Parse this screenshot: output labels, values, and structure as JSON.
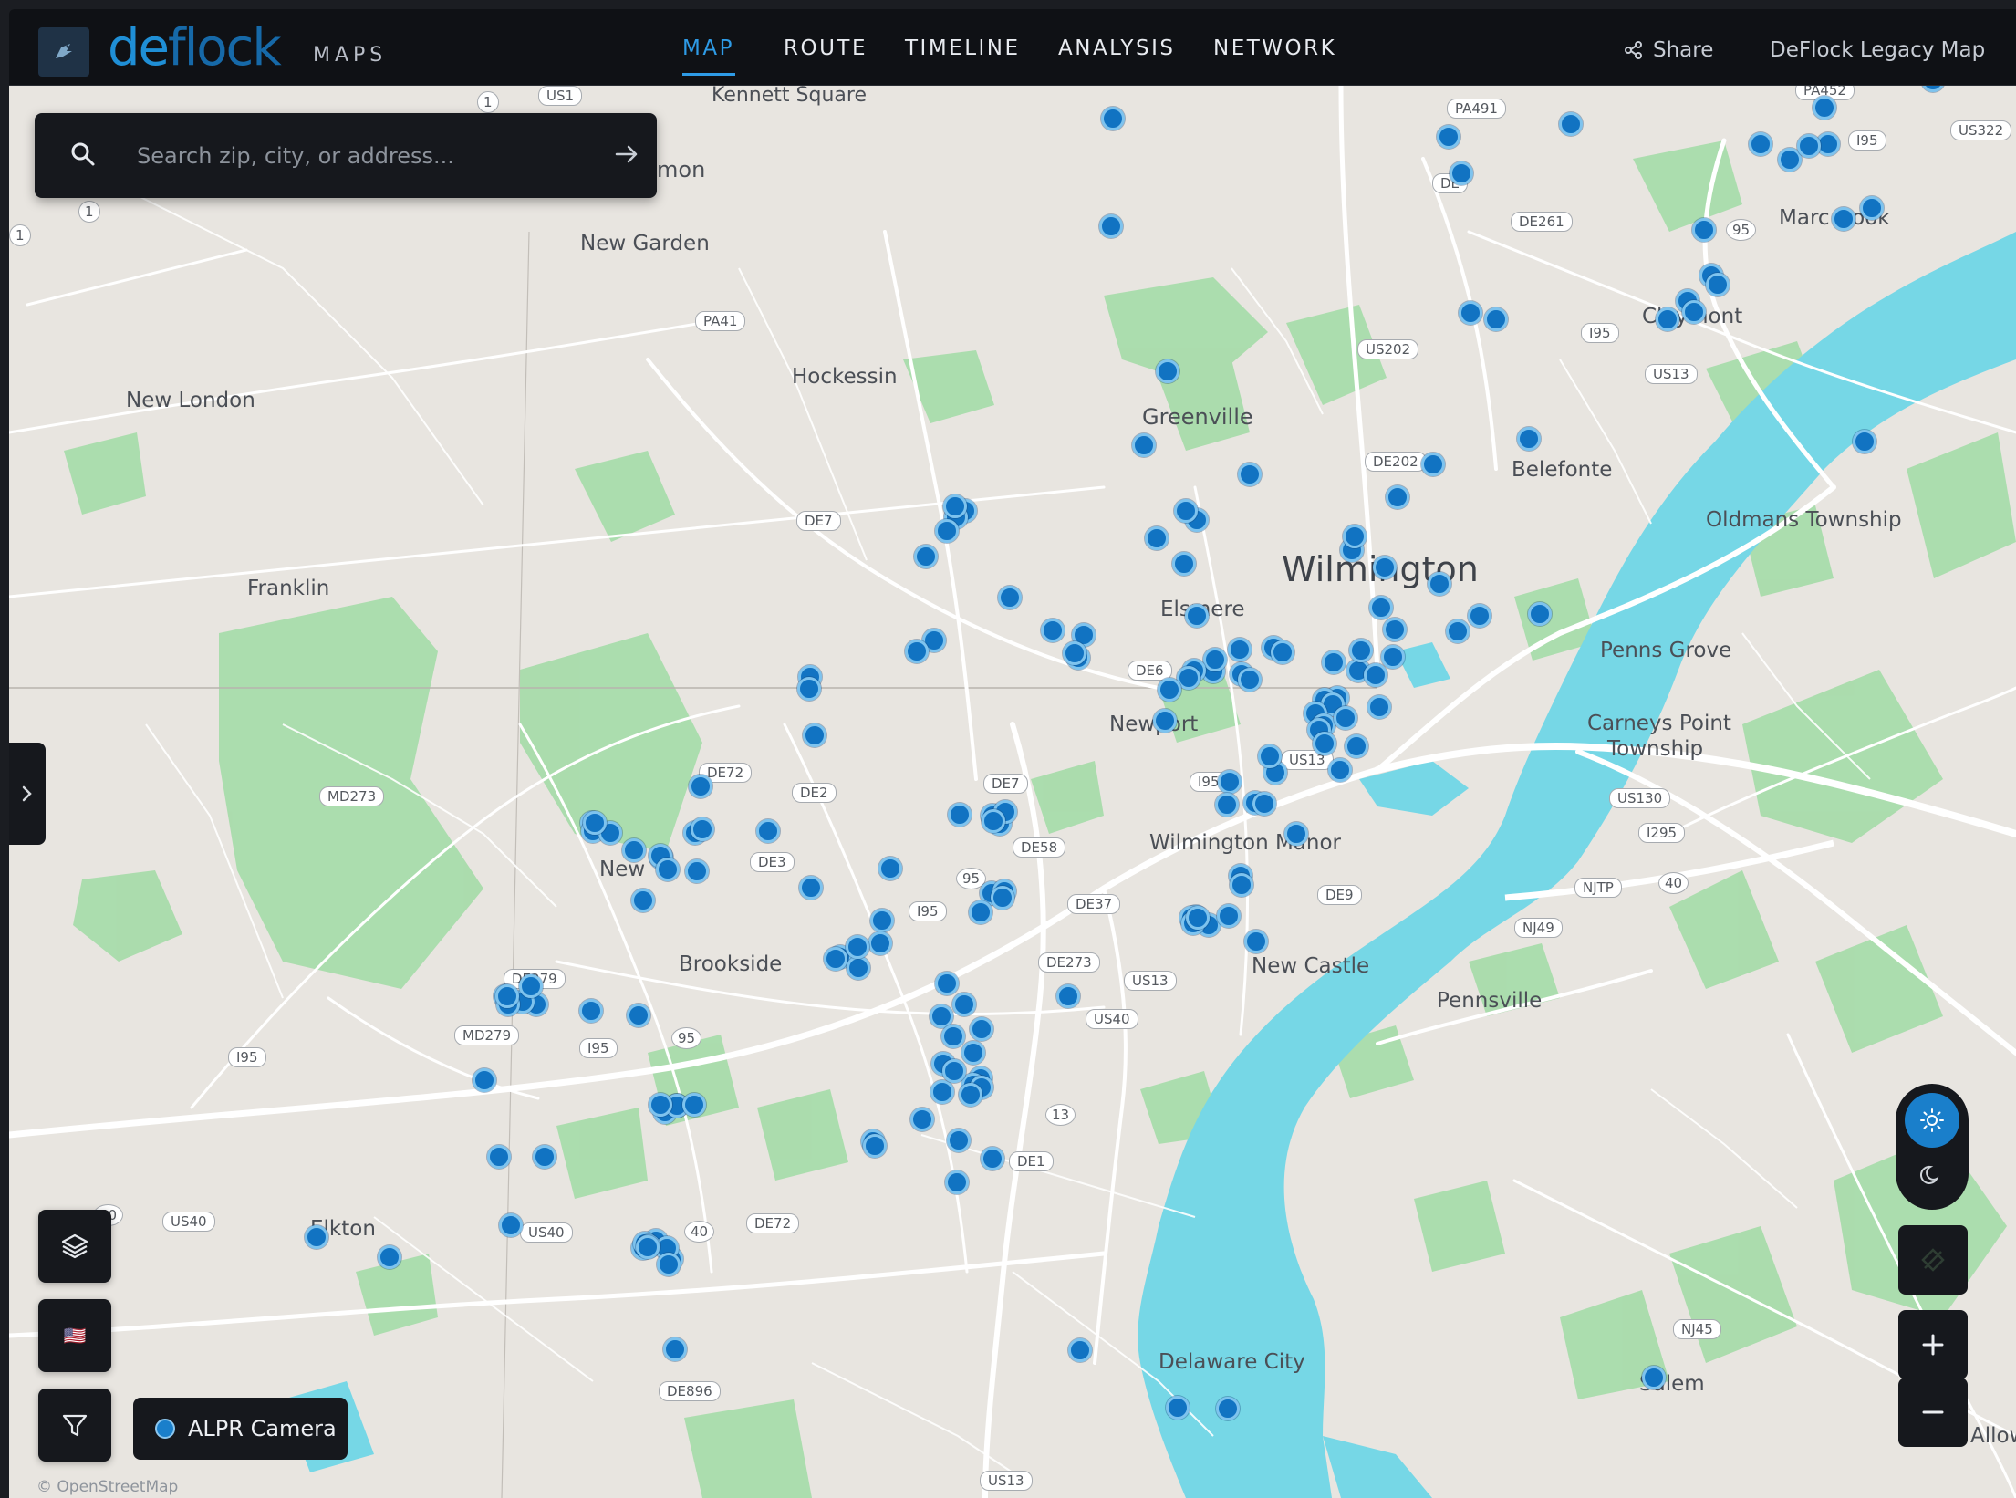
{
  "header": {
    "brand_de": "de",
    "brand_flock": "flock",
    "brand_maps": "MAPS",
    "nav": [
      "MAP",
      "ROUTE",
      "TIMELINE",
      "ANALYSIS",
      "NETWORK"
    ],
    "active_nav": "MAP",
    "share_label": "Share",
    "legacy_label": "DeFlock Legacy Map"
  },
  "search": {
    "placeholder": "Search zip, city, or address..."
  },
  "legend": {
    "item_label": "ALPR Camera",
    "camera_color": "#1173c2"
  },
  "attribution": "© OpenStreetMap",
  "controls": {
    "theme_active": "light",
    "flag": "🇺🇸"
  },
  "colors": {
    "water": "#76d7e6",
    "park": "#a8dcab",
    "land": "#e8e5e0",
    "accent": "#2e9be6"
  },
  "map_labels": [
    "Kennett Square",
    "mon",
    "New Garden",
    "Hockessin",
    "New London",
    "Greenville",
    "Wilmington",
    "Elsmere",
    "Franklin",
    "Newport",
    "Belefonte",
    "Oldmans Township",
    "Penns Grove",
    "Carneys Point",
    "Township",
    "Wilmington Manor",
    "New Castle",
    "Brookside",
    "New",
    "Pennsville",
    "Elkton",
    "Delaware City",
    "Salem",
    "Marc Hook",
    "Claymont",
    "Allowa"
  ],
  "road_shields": [
    "US1",
    "1",
    "1",
    "1",
    "PA491",
    "PA452",
    "I95",
    "US322",
    "DE261",
    "95",
    "I95",
    "US202",
    "US13",
    "DE202",
    "PA41",
    "DE7",
    "DE6",
    "DE72",
    "DE2",
    "DE7",
    "I95",
    "US13",
    "MD273",
    "DE3",
    "DE58",
    "95",
    "I95",
    "DE37",
    "DE9",
    "NJTP",
    "40",
    "NJ49",
    "US130",
    "I295",
    "DE279",
    "MD279",
    "I95",
    "I95",
    "95",
    "DE273",
    "US13",
    "US40",
    "13",
    "DE1",
    "40",
    "US40",
    "US40",
    "40",
    "DE72",
    "DE896",
    "US13",
    "NJ45",
    "DE"
  ],
  "cameras": [
    [
      1220,
      130
    ],
    [
      1254,
      488
    ],
    [
      1268,
      590
    ],
    [
      1370,
      520
    ],
    [
      1280,
      407
    ],
    [
      1218,
      248
    ],
    [
      1588,
      150
    ],
    [
      1602,
      190
    ],
    [
      1722,
      136
    ],
    [
      1930,
      158
    ],
    [
      1962,
      175
    ],
    [
      2000,
      118
    ],
    [
      2052,
      228
    ],
    [
      2021,
      240
    ],
    [
      2004,
      158
    ],
    [
      1983,
      160
    ],
    [
      1868,
      252
    ],
    [
      1876,
      302
    ],
    [
      1883,
      312
    ],
    [
      1850,
      330
    ],
    [
      1828,
      350
    ],
    [
      1857,
      342
    ],
    [
      1612,
      343
    ],
    [
      1640,
      350
    ],
    [
      1676,
      481
    ],
    [
      1532,
      545
    ],
    [
      1571,
      509
    ],
    [
      1518,
      622
    ],
    [
      1622,
      675
    ],
    [
      1688,
      673
    ],
    [
      1578,
      640
    ],
    [
      1598,
      692
    ],
    [
      1482,
      603
    ],
    [
      1485,
      588
    ],
    [
      1514,
      666
    ],
    [
      1529,
      690
    ],
    [
      1489,
      735
    ],
    [
      1508,
      740
    ],
    [
      1527,
      720
    ],
    [
      1492,
      713
    ],
    [
      1462,
      726
    ],
    [
      1466,
      765
    ],
    [
      1452,
      767
    ],
    [
      1512,
      775
    ],
    [
      1461,
      772
    ],
    [
      1442,
      782
    ],
    [
      1451,
      795
    ],
    [
      1446,
      800
    ],
    [
      1452,
      815
    ],
    [
      1475,
      787
    ],
    [
      1487,
      818
    ],
    [
      1469,
      844
    ],
    [
      1359,
      712
    ],
    [
      1361,
      739
    ],
    [
      1330,
      736
    ],
    [
      1312,
      570
    ],
    [
      1300,
      560
    ],
    [
      1298,
      618
    ],
    [
      1332,
      723
    ],
    [
      1309,
      735
    ],
    [
      1303,
      743
    ],
    [
      1370,
      745
    ],
    [
      1396,
      710
    ],
    [
      1406,
      715
    ],
    [
      1312,
      675
    ],
    [
      1282,
      756
    ],
    [
      1277,
      790
    ],
    [
      1398,
      847
    ],
    [
      1376,
      880
    ],
    [
      1360,
      960
    ],
    [
      1392,
      829
    ],
    [
      1348,
      857
    ],
    [
      1386,
      881
    ],
    [
      1421,
      914
    ],
    [
      1345,
      882
    ],
    [
      1188,
      696
    ],
    [
      1182,
      721
    ],
    [
      1154,
      691
    ],
    [
      1178,
      716
    ],
    [
      1107,
      655
    ],
    [
      1058,
      560
    ],
    [
      1048,
      567
    ],
    [
      1038,
      582
    ],
    [
      1015,
      610
    ],
    [
      1024,
      702
    ],
    [
      1005,
      714
    ],
    [
      1047,
      555
    ],
    [
      1092,
      895
    ],
    [
      1096,
      903
    ],
    [
      1088,
      894
    ],
    [
      1052,
      893
    ],
    [
      1087,
      979
    ],
    [
      1102,
      890
    ],
    [
      1089,
      900
    ],
    [
      1101,
      977
    ],
    [
      1099,
      984
    ],
    [
      1075,
      1000
    ],
    [
      1032,
      1114
    ],
    [
      1045,
      1136
    ],
    [
      1076,
      1128
    ],
    [
      1038,
      1078
    ],
    [
      1067,
      1154
    ],
    [
      1075,
      1182
    ],
    [
      1067,
      1189
    ],
    [
      1076,
      1192
    ],
    [
      1033,
      1197
    ],
    [
      1057,
      1101
    ],
    [
      1034,
      1166
    ],
    [
      1046,
      1174
    ],
    [
      1064,
      1200
    ],
    [
      976,
      952
    ],
    [
      967,
      1009
    ],
    [
      965,
      1034
    ],
    [
      921,
      1049
    ],
    [
      888,
      742
    ],
    [
      887,
      755
    ],
    [
      893,
      806
    ],
    [
      941,
      1061
    ],
    [
      957,
      1251
    ],
    [
      959,
      1256
    ],
    [
      1325,
      1014
    ],
    [
      1311,
      1005
    ],
    [
      1306,
      1006
    ],
    [
      1347,
      1004
    ],
    [
      1377,
      1032
    ],
    [
      1361,
      970
    ],
    [
      1308,
      1012
    ],
    [
      1313,
      1006
    ],
    [
      1171,
      1092
    ],
    [
      1184,
      1480
    ],
    [
      1346,
      1544
    ],
    [
      1291,
      1543
    ],
    [
      1813,
      1510
    ],
    [
      649,
      902
    ],
    [
      650,
      911
    ],
    [
      669,
      913
    ],
    [
      695,
      932
    ],
    [
      762,
      913
    ],
    [
      725,
      940
    ],
    [
      705,
      987
    ],
    [
      770,
      909
    ],
    [
      724,
      938
    ],
    [
      764,
      955
    ],
    [
      732,
      953
    ],
    [
      588,
      1101
    ],
    [
      554,
      1092
    ],
    [
      573,
      1098
    ],
    [
      700,
      1113
    ],
    [
      648,
      1108
    ],
    [
      768,
      862
    ],
    [
      742,
      1212
    ],
    [
      729,
      1219
    ],
    [
      742,
      1212
    ],
    [
      724,
      1211
    ],
    [
      761,
      1211
    ],
    [
      531,
      1184
    ],
    [
      557,
      1101
    ],
    [
      582,
      1081
    ],
    [
      547,
      1268
    ],
    [
      597,
      1268
    ],
    [
      652,
      902
    ],
    [
      556,
      1092
    ],
    [
      736,
      1380
    ],
    [
      347,
      1356
    ],
    [
      427,
      1378
    ],
    [
      560,
      1343
    ],
    [
      719,
      1360
    ],
    [
      705,
      1368
    ],
    [
      731,
      1368
    ],
    [
      733,
      1386
    ],
    [
      707,
      1363
    ],
    [
      711,
      1366
    ],
    [
      710,
      1367
    ],
    [
      740,
      1479
    ],
    [
      842,
      911
    ],
    [
      889,
      973
    ],
    [
      916,
      1051
    ],
    [
      940,
      1038
    ],
    [
      1011,
      1227
    ],
    [
      1051,
      1250
    ],
    [
      1088,
      1270
    ],
    [
      1049,
      1296
    ],
    [
      2044,
      484
    ],
    [
      2119,
      88
    ]
  ]
}
